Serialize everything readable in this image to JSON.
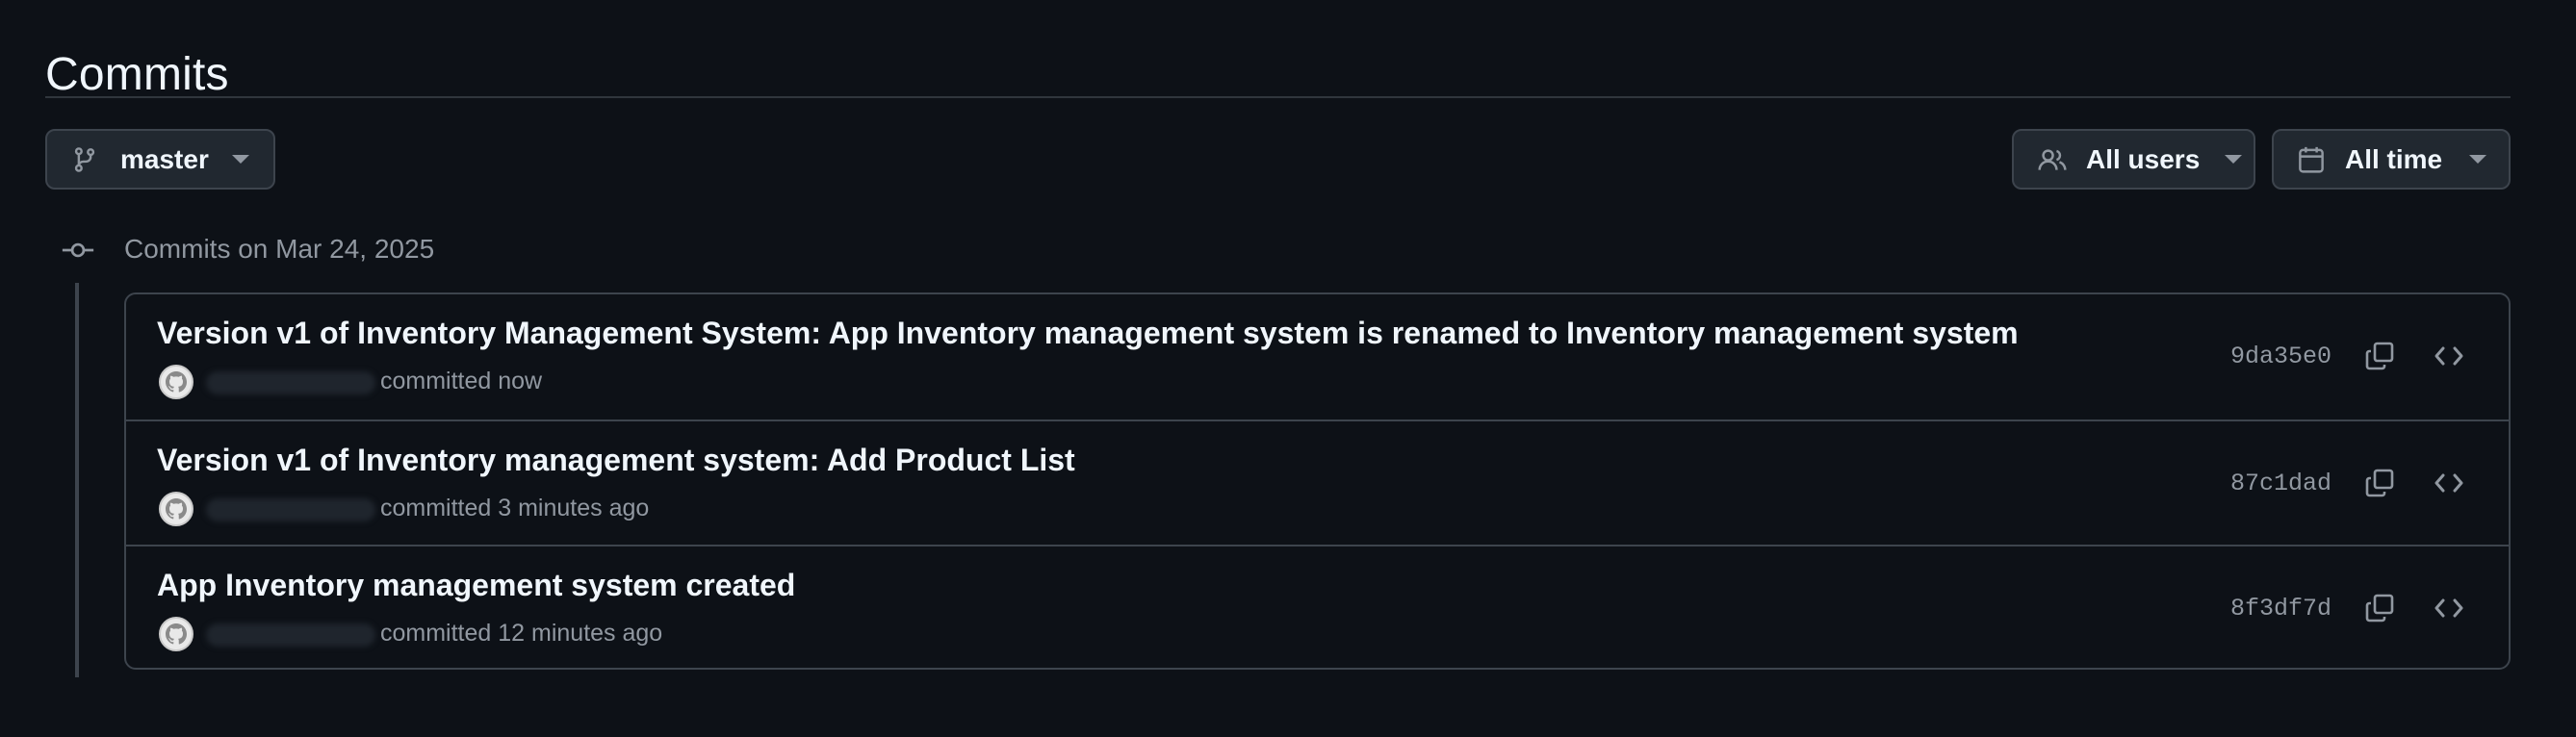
{
  "page": {
    "title": "Commits"
  },
  "toolbar": {
    "branch_label": "master",
    "branch_icon": "git-branch-icon",
    "users_label": "All users",
    "users_icon": "people-icon",
    "time_label": "All time",
    "time_icon": "calendar-icon"
  },
  "group": {
    "heading": "Commits on Mar 24, 2025",
    "icon": "git-commit-icon"
  },
  "commits": [
    {
      "message": "Version v1 of Inventory Management System: App Inventory management system is renamed to Inventory management system",
      "meta": "committed now",
      "sha": "9da35e0"
    },
    {
      "message": "Version v1 of Inventory management system: Add Product List",
      "meta": "committed 3 minutes ago",
      "sha": "87c1dad"
    },
    {
      "message": "App Inventory management system created",
      "meta": "committed 12 minutes ago",
      "sha": "8f3df7d"
    }
  ],
  "colors": {
    "background": "#0d1117",
    "border": "#3d444d",
    "muted_text": "#9198a1",
    "primary_text": "#f0f6fc",
    "button_bg": "#212830"
  }
}
